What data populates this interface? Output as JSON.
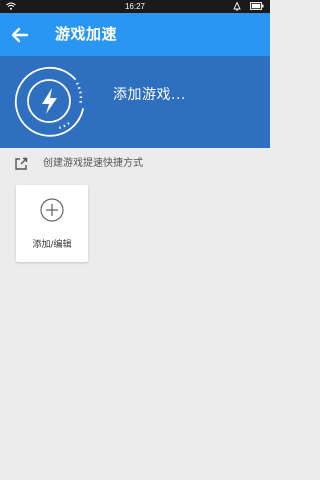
{
  "status_bar": {
    "time": "16:27",
    "icons": [
      "wifi-icon",
      "bell-icon",
      "battery-icon"
    ]
  },
  "app_bar": {
    "title": "游戏加速",
    "back_icon": "arrow-left-icon",
    "background": "#2a96f3"
  },
  "hero": {
    "status_text": "添加游戏...",
    "icon": "lightning-bolt-icon",
    "background": "#2e6fbf"
  },
  "shortcut_hint": {
    "text": "创建游戏提速快捷方式",
    "icon": "external-link-icon"
  },
  "add_card": {
    "label": "添加/编辑",
    "icon": "plus-circle-icon"
  },
  "colors": {
    "page_background": "#ececec",
    "status_bar": "#1a1a1a"
  }
}
